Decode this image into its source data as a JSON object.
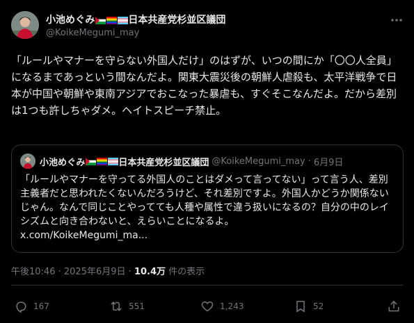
{
  "author": {
    "display_name": "小池めぐみ",
    "flags": [
      "palestine-flag",
      "rainbow-flag",
      "transgender-flag"
    ],
    "affiliation": "日本共産党杉並区議団",
    "handle": "@KoikeMegumi_may"
  },
  "post": {
    "text": "「ルールやマナーを守らない外国人だけ」のはずが、いつの間にか「〇〇人全員」になるまであっという間なんだよ。関東大震災後の朝鮮人虐殺も、太平洋戦争で日本が中国や朝鮮や東南アジアでおこなった暴虐も、すぐそこなんだよ。だから差別は1つも許しちゃダメ。ヘイトスピーチ禁止。"
  },
  "quoted_post": {
    "display_name": "小池めぐみ",
    "affiliation": "日本共産党杉並区議団",
    "handle": "@KoikeMegumi_may",
    "separator": "·",
    "date": "6月9日",
    "text": "「ルールやマナーを守ってる外国人のことはダメって言ってない」って言う人、差別主義者だと思われたくないんだろうけど、それ差別ですよ。外国人かどうか関係ないじゃん。なんで同じことやってても人種や属性で違う扱いになるの？自分の中のレイシズムと向き合わないと、えらいことになるよ。",
    "link": "x.com/KoikeMegumi_ma..."
  },
  "meta": {
    "time": "午後10:46",
    "separator": "·",
    "date": "2025年6月9日",
    "views": "10.4万",
    "views_label": "件の表示"
  },
  "actions": {
    "replies": "167",
    "reposts": "551",
    "likes": "1,243",
    "bookmarks": "52"
  },
  "colors": {
    "background": "#000000",
    "text": "#e7e9ea",
    "secondary": "#71767b",
    "border": "#2f3336"
  },
  "icons": {
    "more": "more-dots-icon",
    "reply": "reply-icon",
    "repost": "repost-icon",
    "like": "heart-icon",
    "bookmark": "bookmark-icon",
    "share": "share-icon"
  }
}
